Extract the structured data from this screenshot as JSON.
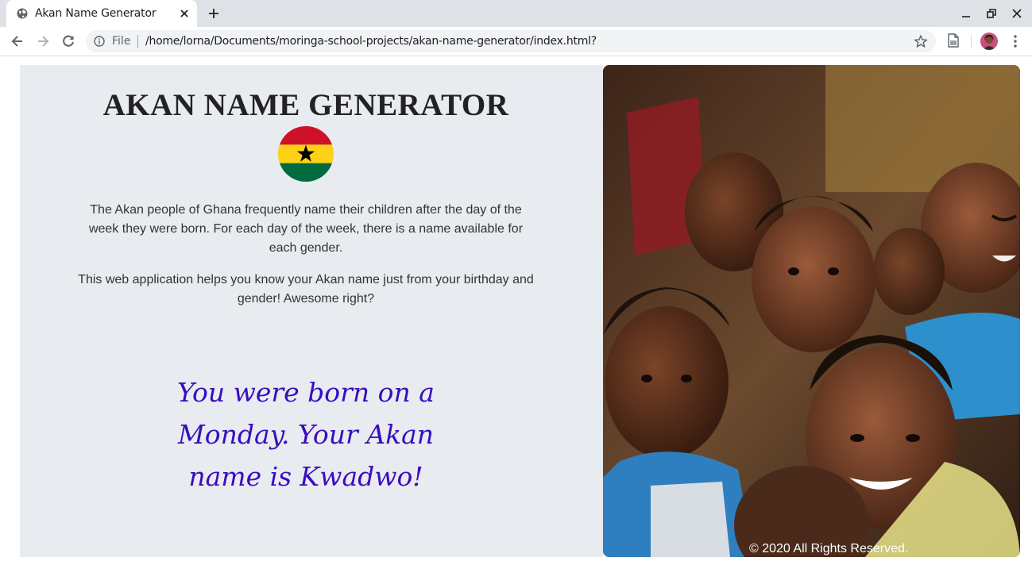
{
  "browser": {
    "tab_title": "Akan Name Generator",
    "scheme_label": "File",
    "url": "/home/lorna/Documents/moringa-school-projects/akan-name-generator/index.html?"
  },
  "icons": {
    "favicon": "globe-icon",
    "close": "close-icon",
    "new_tab": "plus-icon",
    "back": "back-arrow-icon",
    "forward": "forward-arrow-icon",
    "reload": "reload-icon",
    "info": "info-icon",
    "bookmark": "star-icon",
    "reader": "document-icon",
    "menu": "kebab-menu-icon"
  },
  "page": {
    "title": "AKAN NAME GENERATOR",
    "intro": "The Akan people of Ghana frequently name their children after the day of the week they were born. For each day of the week, there is a name available for each gender.",
    "description": "This web application helps you know your Akan name just from your birthday and gender! Awesome right?",
    "result": "You were born on a Monday. Your Akan name is Kwadwo!",
    "footer": "© 2020 All Rights Reserved."
  },
  "colors": {
    "panel_bg": "#e8ebef",
    "result_text": "#3a0dbf",
    "flag_red": "#ce1126",
    "flag_gold": "#fcd116",
    "flag_green": "#006b3f"
  }
}
